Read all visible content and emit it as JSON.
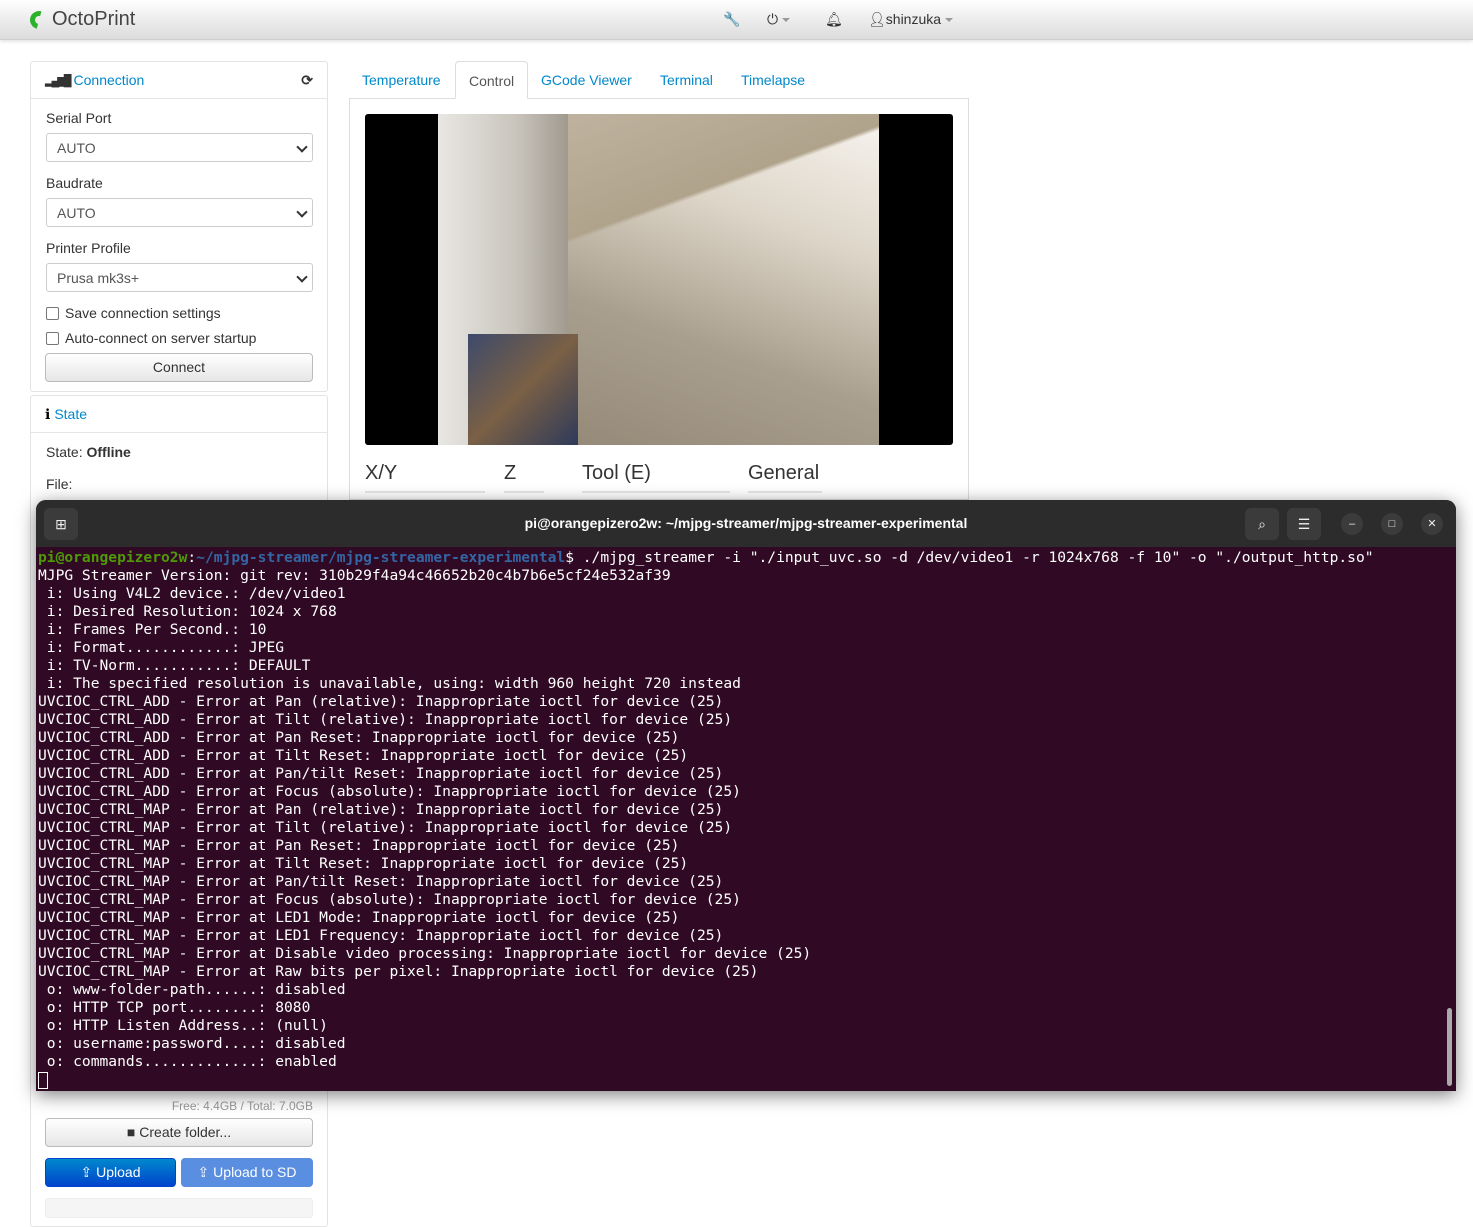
{
  "navbar": {
    "brand": "OctoPrint",
    "user": "shinzuka",
    "brand_color": "#2bb12b"
  },
  "connection": {
    "title": "Connection",
    "serial_port_label": "Serial Port",
    "serial_port": "AUTO",
    "baudrate_label": "Baudrate",
    "baudrate": "AUTO",
    "profile_label": "Printer Profile",
    "profile": "Prusa mk3s+",
    "save_settings": "Save connection settings",
    "autoconnect": "Auto-connect on server startup",
    "connect_button": "Connect"
  },
  "state": {
    "title": "State",
    "state_label": "State:",
    "state_value": "Offline",
    "file_label": "File:"
  },
  "files": {
    "storage": "Free: 4.4GB / Total: 7.0GB",
    "create_folder": "Create folder...",
    "upload": "Upload",
    "upload_sd": "Upload to SD"
  },
  "tabs": [
    "Temperature",
    "Control",
    "GCode Viewer",
    "Terminal",
    "Timelapse"
  ],
  "active_tab": "Control",
  "control_sections": [
    "X/Y",
    "Z",
    "Tool (E)",
    "General"
  ],
  "terminal": {
    "title": "pi@orangepizero2w: ~/mjpg-streamer/mjpg-streamer-experimental",
    "prompt_user": "pi@orangepizero2w",
    "prompt_path": "~/mjpg-streamer/mjpg-streamer-experimental",
    "command": "$ ./mjpg_streamer -i \"./input_uvc.so -d /dev/video1 -r 1024x768 -f 10\" -o \"./output_http.so\"",
    "background": "#300a24",
    "lines": [
      "MJPG Streamer Version: git rev: 310b29f4a94c46652b20c4b7b6e5cf24e532af39",
      " i: Using V4L2 device.: /dev/video1",
      " i: Desired Resolution: 1024 x 768",
      " i: Frames Per Second.: 10",
      " i: Format............: JPEG",
      " i: TV-Norm...........: DEFAULT",
      " i: The specified resolution is unavailable, using: width 960 height 720 instead",
      "UVCIOC_CTRL_ADD - Error at Pan (relative): Inappropriate ioctl for device (25)",
      "UVCIOC_CTRL_ADD - Error at Tilt (relative): Inappropriate ioctl for device (25)",
      "UVCIOC_CTRL_ADD - Error at Pan Reset: Inappropriate ioctl for device (25)",
      "UVCIOC_CTRL_ADD - Error at Tilt Reset: Inappropriate ioctl for device (25)",
      "UVCIOC_CTRL_ADD - Error at Pan/tilt Reset: Inappropriate ioctl for device (25)",
      "UVCIOC_CTRL_ADD - Error at Focus (absolute): Inappropriate ioctl for device (25)",
      "UVCIOC_CTRL_MAP - Error at Pan (relative): Inappropriate ioctl for device (25)",
      "UVCIOC_CTRL_MAP - Error at Tilt (relative): Inappropriate ioctl for device (25)",
      "UVCIOC_CTRL_MAP - Error at Pan Reset: Inappropriate ioctl for device (25)",
      "UVCIOC_CTRL_MAP - Error at Tilt Reset: Inappropriate ioctl for device (25)",
      "UVCIOC_CTRL_MAP - Error at Pan/tilt Reset: Inappropriate ioctl for device (25)",
      "UVCIOC_CTRL_MAP - Error at Focus (absolute): Inappropriate ioctl for device (25)",
      "UVCIOC_CTRL_MAP - Error at LED1 Mode: Inappropriate ioctl for device (25)",
      "UVCIOC_CTRL_MAP - Error at LED1 Frequency: Inappropriate ioctl for device (25)",
      "UVCIOC_CTRL_MAP - Error at Disable video processing: Inappropriate ioctl for device (25)",
      "UVCIOC_CTRL_MAP - Error at Raw bits per pixel: Inappropriate ioctl for device (25)",
      " o: www-folder-path......: disabled",
      " o: HTTP TCP port........: 8080",
      " o: HTTP Listen Address..: (null)",
      " o: username:password....: disabled",
      " o: commands.............: enabled"
    ]
  }
}
